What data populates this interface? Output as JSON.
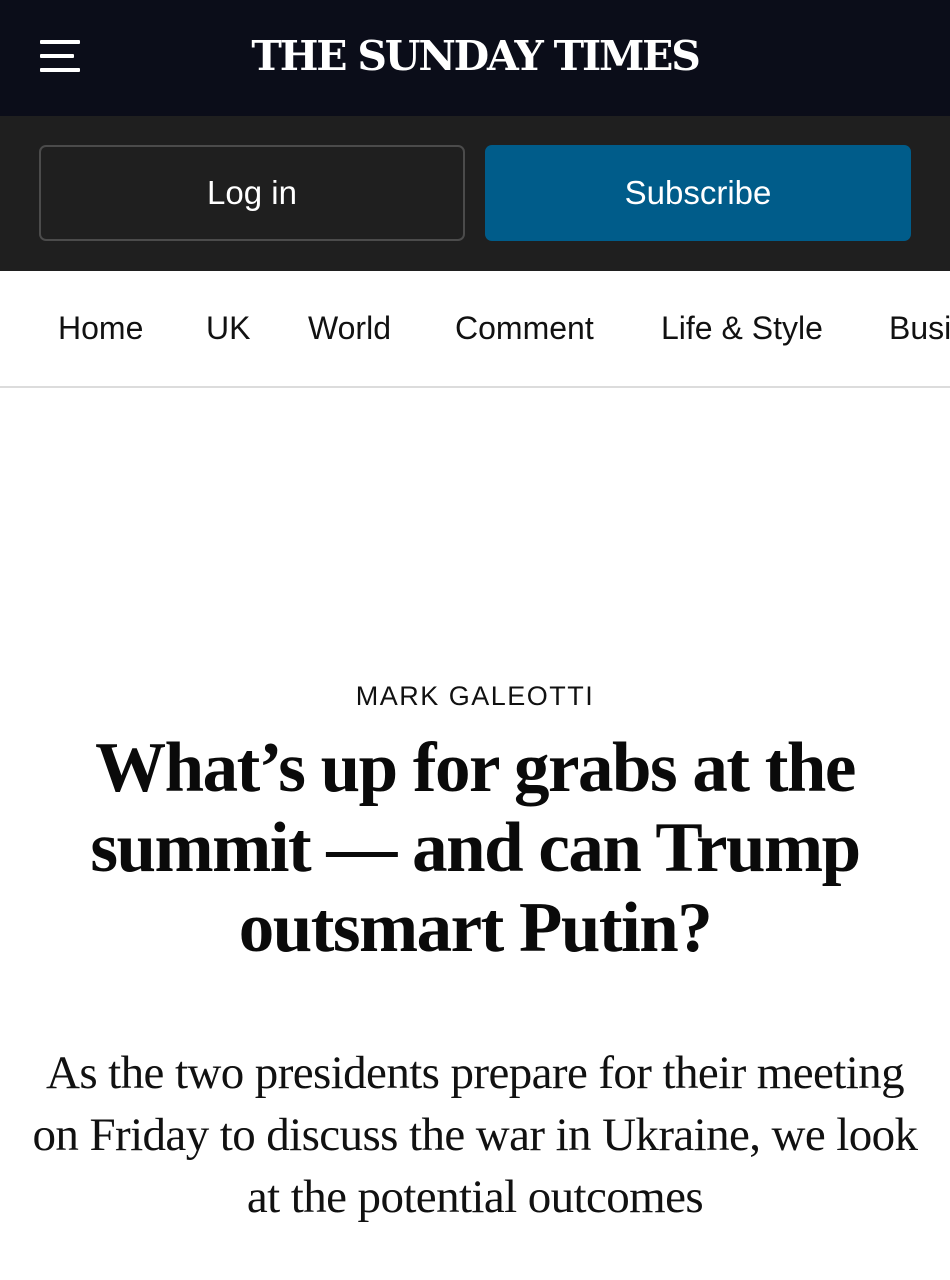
{
  "header": {
    "menu_icon": "hamburger-menu-icon",
    "masthead": "THE SUNDAY TIMES",
    "background_color": "#0b0d19"
  },
  "auth": {
    "login_label": "Log in",
    "subscribe_label": "Subscribe",
    "subscribe_color": "#005c8a"
  },
  "nav": {
    "items": [
      {
        "label": "Home"
      },
      {
        "label": "UK"
      },
      {
        "label": "World"
      },
      {
        "label": "Comment"
      },
      {
        "label": "Life & Style"
      },
      {
        "label": "Busi"
      }
    ]
  },
  "article": {
    "byline": "MARK GALEOTTI",
    "headline": "What’s up for grabs at the summit — and can Trump outsmart Putin?",
    "standfirst": "As the two presidents prepare for their meeting on Friday to discuss the war in Ukraine, we look at the potential outcomes"
  }
}
